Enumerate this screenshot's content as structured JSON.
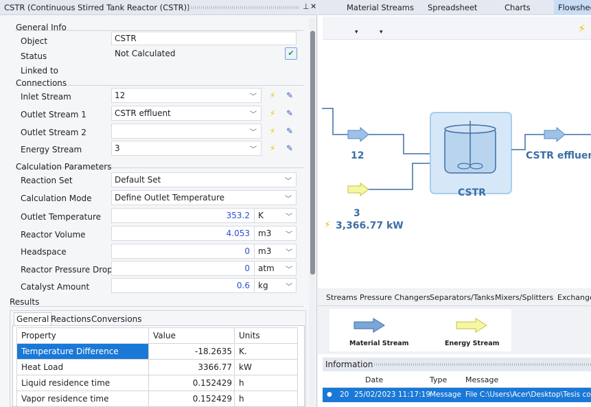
{
  "left_panel": {
    "title": "CSTR (Continuous Stirred Tank Reactor (CSTR))",
    "general_info": {
      "heading": "General Info",
      "object_label": "Object",
      "object_value": "CSTR",
      "status_label": "Status",
      "status_value": "Not Calculated",
      "linked_label": "Linked to"
    },
    "connections": {
      "heading": "Connections",
      "rows": [
        {
          "label": "Inlet Stream",
          "value": "12"
        },
        {
          "label": "Outlet Stream 1",
          "value": "CSTR effluent"
        },
        {
          "label": "Outlet Stream 2",
          "value": ""
        },
        {
          "label": "Energy Stream",
          "value": "3"
        }
      ]
    },
    "calc_params": {
      "heading": "Calculation Parameters",
      "reaction_set_label": "Reaction Set",
      "reaction_set_value": "Default Set",
      "calc_mode_label": "Calculation Mode",
      "calc_mode_value": "Define Outlet Temperature",
      "rows": [
        {
          "label": "Outlet Temperature",
          "value": "353.2",
          "unit": "K"
        },
        {
          "label": "Reactor Volume",
          "value": "4.053",
          "unit": "m3"
        },
        {
          "label": "Headspace",
          "value": "0",
          "unit": "m3"
        },
        {
          "label": "Reactor Pressure Drop",
          "value": "0",
          "unit": "atm"
        },
        {
          "label": "Catalyst Amount",
          "value": "0.6",
          "unit": "kg"
        }
      ]
    },
    "results": {
      "heading": "Results",
      "tabs": [
        "General",
        "Reactions",
        "Conversions"
      ],
      "columns": [
        "Property",
        "Value",
        "Units"
      ],
      "rows": [
        {
          "property": "Temperature Difference",
          "value": "-18.2635",
          "unit": "K."
        },
        {
          "property": "Heat Load",
          "value": "3366.77",
          "unit": "kW"
        },
        {
          "property": "Liquid residence time",
          "value": "0.152429",
          "unit": "h"
        },
        {
          "property": "Vapor residence time",
          "value": "0.152429",
          "unit": "h"
        }
      ]
    }
  },
  "right_panel": {
    "tabs": [
      "Material Streams",
      "Spreadsheet",
      "Charts",
      "Flowsheet"
    ],
    "flowsheet": {
      "inlet_label": "12",
      "outlet_label": "CSTR effluent",
      "reactor_label": "CSTR",
      "energy_label": "3",
      "energy_value": "3,366.77 kW"
    },
    "palette": {
      "tabs": [
        "Streams",
        "Pressure Changers",
        "Separators/Tanks",
        "Mixers/Splitters",
        "Exchange"
      ],
      "items": [
        {
          "label": "Material Stream"
        },
        {
          "label": "Energy Stream"
        }
      ]
    },
    "information": {
      "title": "Information",
      "columns": [
        "Date",
        "Type",
        "Message"
      ],
      "row": {
        "num": "20",
        "date": "25/02/2023 11:17:19",
        "type": "Message",
        "message": "File C:\\Users\\Acer\\Desktop\\Tesis comp"
      }
    }
  },
  "colors": {
    "accent": "#1a78d6",
    "value_blue": "#2a4fd6",
    "flow_label": "#3b6ea5",
    "bolt": "#f5c000"
  }
}
